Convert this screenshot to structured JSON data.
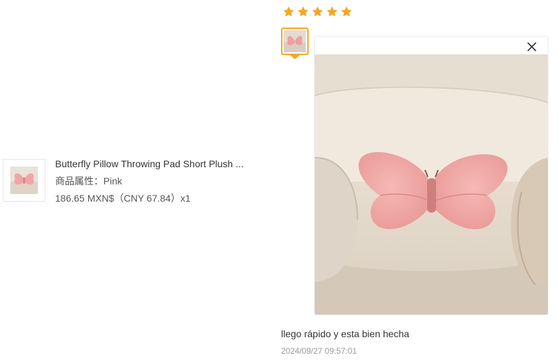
{
  "product": {
    "title": "Butterfly Pillow Throwing Pad Short Plush ...",
    "attribute": "商品属性：Pink",
    "price": "186.65 MXN$（CNY  67.84）x1"
  },
  "review": {
    "rating": 5,
    "text": "llego rápido y esta bien hecha",
    "date": "2024/09/27 09:57:01"
  },
  "colors": {
    "star": "#f5a623",
    "selected_border": "#f5a623",
    "pillow": "#f0a6a6",
    "sofa": "#ece3d6"
  },
  "icons": {
    "star": "star-icon",
    "close": "close-icon"
  }
}
